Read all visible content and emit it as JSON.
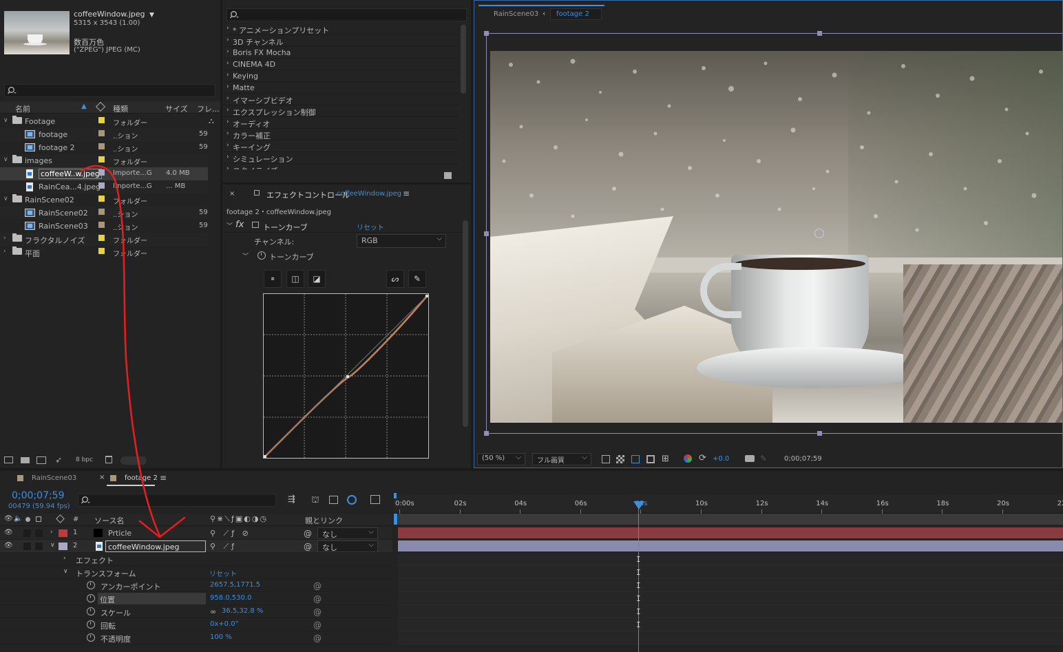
{
  "project": {
    "file_name": "coffeeWindow.jpeg",
    "dimensions": "5315 x 3543 (1.00)",
    "color_desc": "数百万色",
    "format": "(\"ZPEG\") JPEG (MC)",
    "columns": {
      "name": "名前",
      "type": "種類",
      "size": "サイズ",
      "frame": "フレ..."
    },
    "bpc": "8 bpc",
    "items": [
      {
        "label": "Footage",
        "type": "フォルダー",
        "size": "",
        "color": "#e6d43a",
        "kind": "folder",
        "indent": 0,
        "expanded": true
      },
      {
        "label": "footage",
        "type": "..ション",
        "size": "59",
        "color": "#a8977a",
        "kind": "comp",
        "indent": 1
      },
      {
        "label": "footage 2",
        "type": "..ション",
        "size": "59",
        "color": "#a8977a",
        "kind": "comp",
        "indent": 1
      },
      {
        "label": "images",
        "type": "フォルダー",
        "size": "",
        "color": "#e6d43a",
        "kind": "folder",
        "indent": 0,
        "expanded": true
      },
      {
        "label": "coffeeW..w.jpeg",
        "type": "Importe...G",
        "size": "4.0 MB",
        "color": "#a9a9c8",
        "kind": "image",
        "indent": 1,
        "selected": true
      },
      {
        "label": "RainCea...4.jpeg",
        "type": "Importe...G",
        "size": "... MB",
        "color": "#a9a9c8",
        "kind": "image",
        "indent": 1
      },
      {
        "label": "RainScene02",
        "type": "フォルダー",
        "size": "",
        "color": "#e6d43a",
        "kind": "folder",
        "indent": 0,
        "expanded": true
      },
      {
        "label": "RainScene02",
        "type": "..ション",
        "size": "59",
        "color": "#a8977a",
        "kind": "comp",
        "indent": 1
      },
      {
        "label": "RainScene03",
        "type": "..ション",
        "size": "59",
        "color": "#a8977a",
        "kind": "comp",
        "indent": 1
      },
      {
        "label": "フラクタルノイズ",
        "type": "フォルダー",
        "size": "",
        "color": "#e6d43a",
        "kind": "folder",
        "indent": 0,
        "expanded": false
      },
      {
        "label": "平面",
        "type": "フォルダー",
        "size": "",
        "color": "#e6d43a",
        "kind": "folder",
        "indent": 0,
        "expanded": false
      }
    ]
  },
  "effects_presets": {
    "items": [
      "* アニメーションプリセット",
      "3D チャンネル",
      "Boris FX Mocha",
      "CINEMA 4D",
      "Keying",
      "Matte",
      "イマーシブビデオ",
      "エクスプレッション制御",
      "オーディオ",
      "カラー補正",
      "キーイング",
      "シミュレーション",
      "スタイライズ"
    ]
  },
  "effect_controls": {
    "tab_label": "エフェクトコントロール",
    "tab_target": "coffeeWindow.jpeg",
    "breadcrumb": "footage 2・coffeeWindow.jpeg",
    "effect_name": "トーンカーブ",
    "reset_label": "リセット",
    "channel_label": "チャンネル:",
    "channel_value": "RGB",
    "curve_group": "トーンカーブ",
    "fx_glyph": "fx"
  },
  "viewer": {
    "tabs": [
      "RainScene03",
      "footage 2"
    ],
    "zoom": "(50 %)",
    "quality": "フル画質",
    "exposure": "+0.0",
    "timecode": "0;00;07;59"
  },
  "timeline": {
    "tabs": [
      "RainScene03",
      "footage 2"
    ],
    "timecode": "0;00;07;59",
    "frame_info": "00479 (59.94 fps)",
    "col_source": "ソース名",
    "col_parent": "親とリンク",
    "col_hash": "#",
    "ticks": [
      "0:00s",
      "02s",
      "04s",
      "06s",
      "08s",
      "10s",
      "12s",
      "14s",
      "16s",
      "18s",
      "20s",
      "22"
    ],
    "layers": [
      {
        "num": "1",
        "name": "Prticle",
        "parent": "なし",
        "color": "#c0393b",
        "swatch": "#000000"
      },
      {
        "num": "2",
        "name": "coffeeWindow.jpeg",
        "parent": "なし",
        "color": "#a9a9c8"
      }
    ],
    "effects_group": "エフェクト",
    "transform_group": "トランスフォーム",
    "transform_reset": "リセット",
    "properties": [
      {
        "label": "アンカーポイント",
        "value": "2657.5,1771.5"
      },
      {
        "label": "位置",
        "value": "958.0,530.0"
      },
      {
        "label": "スケール",
        "value": "36.5,32.8 %"
      },
      {
        "label": "回転",
        "value": "0x+0.0°"
      },
      {
        "label": "不透明度",
        "value": "100 %"
      }
    ]
  },
  "colors": {
    "accent": "#3d8fe0",
    "annotation": "#e02020",
    "layer1_bar": "#8b3b3f",
    "layer2_bar": "#8a8aad"
  }
}
